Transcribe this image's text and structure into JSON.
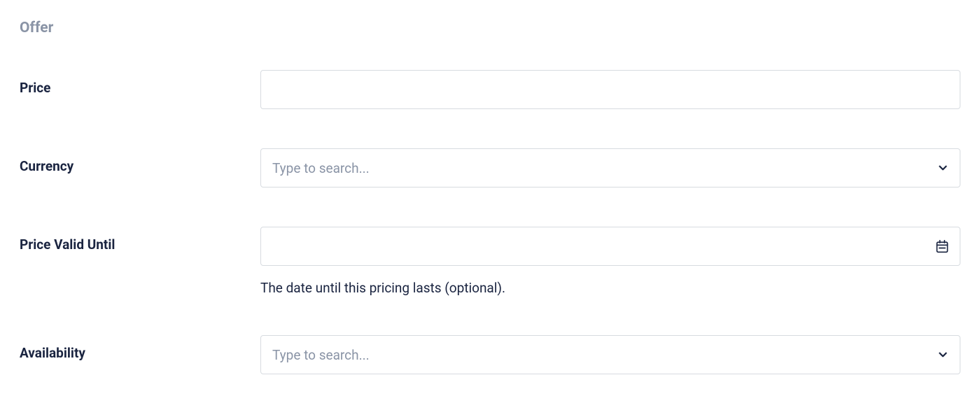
{
  "section": {
    "title": "Offer"
  },
  "fields": {
    "price": {
      "label": "Price",
      "value": ""
    },
    "currency": {
      "label": "Currency",
      "placeholder": "Type to search...",
      "value": ""
    },
    "priceValidUntil": {
      "label": "Price Valid Until",
      "value": "",
      "helper": "The date until this pricing lasts (optional)."
    },
    "availability": {
      "label": "Availability",
      "placeholder": "Type to search...",
      "value": ""
    }
  }
}
